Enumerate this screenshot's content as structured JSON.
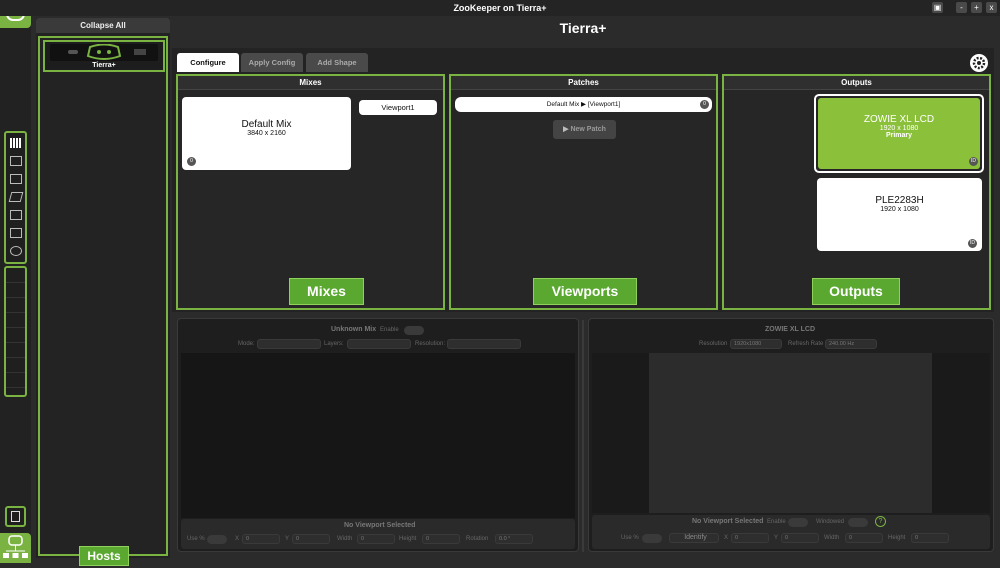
{
  "window": {
    "title": "ZooKeeper on Tierra+",
    "controls": [
      "▣",
      "-",
      "+",
      "x"
    ]
  },
  "hosts": {
    "collapse_label": "Collapse All",
    "host_name": "Tierra+",
    "footer_label": "Hosts"
  },
  "page_title": "Tierra+",
  "tabs": [
    {
      "label": "Configure"
    },
    {
      "label": "Apply Config"
    },
    {
      "label": "Add Shape"
    }
  ],
  "mixes": {
    "heading": "Mixes",
    "card_name": "Default Mix",
    "card_res": "3840 x 2160",
    "card_badge": "0",
    "viewport_label": "Viewport1",
    "footer_label": "Mixes"
  },
  "patches": {
    "heading": "Patches",
    "patch_label": "Default Mix  ▶  [Viewport1]",
    "patch_badge": "0",
    "new_patch_label": "New Patch",
    "footer_label": "Viewports"
  },
  "outputs": {
    "heading": "Outputs",
    "items": [
      {
        "name": "ZOWIE XL LCD",
        "res": "1920 x 1080",
        "tag": "Primary",
        "badge": "ID"
      },
      {
        "name": "PLE2283H",
        "res": "1920 x 1080",
        "tag": "",
        "badge": "ID"
      }
    ],
    "footer_label": "Outputs"
  },
  "mix_detail": {
    "title": "Unknown Mix",
    "enable_label": "Enable",
    "mode_label": "Mode:",
    "layers_label": "Layers:",
    "resolution_label": "Resolution:",
    "no_viewport": "No Viewport Selected",
    "use_pct": "Use %",
    "x_label": "X",
    "x": "0",
    "y_label": "Y",
    "y": "0",
    "width_label": "Width",
    "width": "0",
    "height_label": "Height",
    "height": "0",
    "rotation_label": "Rotation",
    "rotation": "0.0 °"
  },
  "output_detail": {
    "title": "ZOWIE XL LCD",
    "resolution_label": "Resolution",
    "resolution": "1920x1080",
    "refresh_label": "Refresh Rate",
    "refresh": "240.00 Hz",
    "no_viewport": "No Viewport Selected",
    "enable_label": "Enable",
    "windowed_label": "Windowed",
    "help": "?",
    "use_pct": "Use %",
    "identify": "Identify",
    "x_label": "X",
    "x": "0",
    "y_label": "Y",
    "y": "0",
    "width_label": "Width",
    "width": "0",
    "height_label": "Height",
    "height": "0"
  },
  "colors": {
    "accent": "#7ab342",
    "button": "#5aa830",
    "primary_output": "#8bc13a"
  }
}
